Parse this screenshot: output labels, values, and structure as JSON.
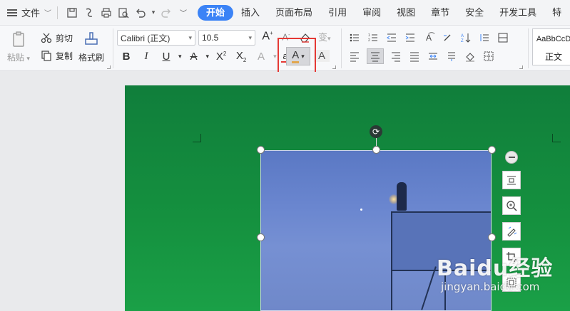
{
  "menubar": {
    "file_label": "文件",
    "tabs": [
      "开始",
      "插入",
      "页面布局",
      "引用",
      "审阅",
      "视图",
      "章节",
      "安全",
      "开发工具",
      "特"
    ]
  },
  "ribbon": {
    "clipboard": {
      "paste": "粘贴",
      "cut": "剪切",
      "copy": "复制",
      "format_painter": "格式刷"
    },
    "font": {
      "name": "Calibri (正文)",
      "size": "10.5",
      "phonetic": "变"
    },
    "styles": {
      "sample": "AaBbCcD",
      "normal": "正文"
    }
  },
  "watermark": {
    "logo": "Baidu经验",
    "url": "jingyan.baidu.com"
  },
  "colors": {
    "accent": "#3b83f6",
    "highlight": "#e53935",
    "page": "#15913f"
  }
}
